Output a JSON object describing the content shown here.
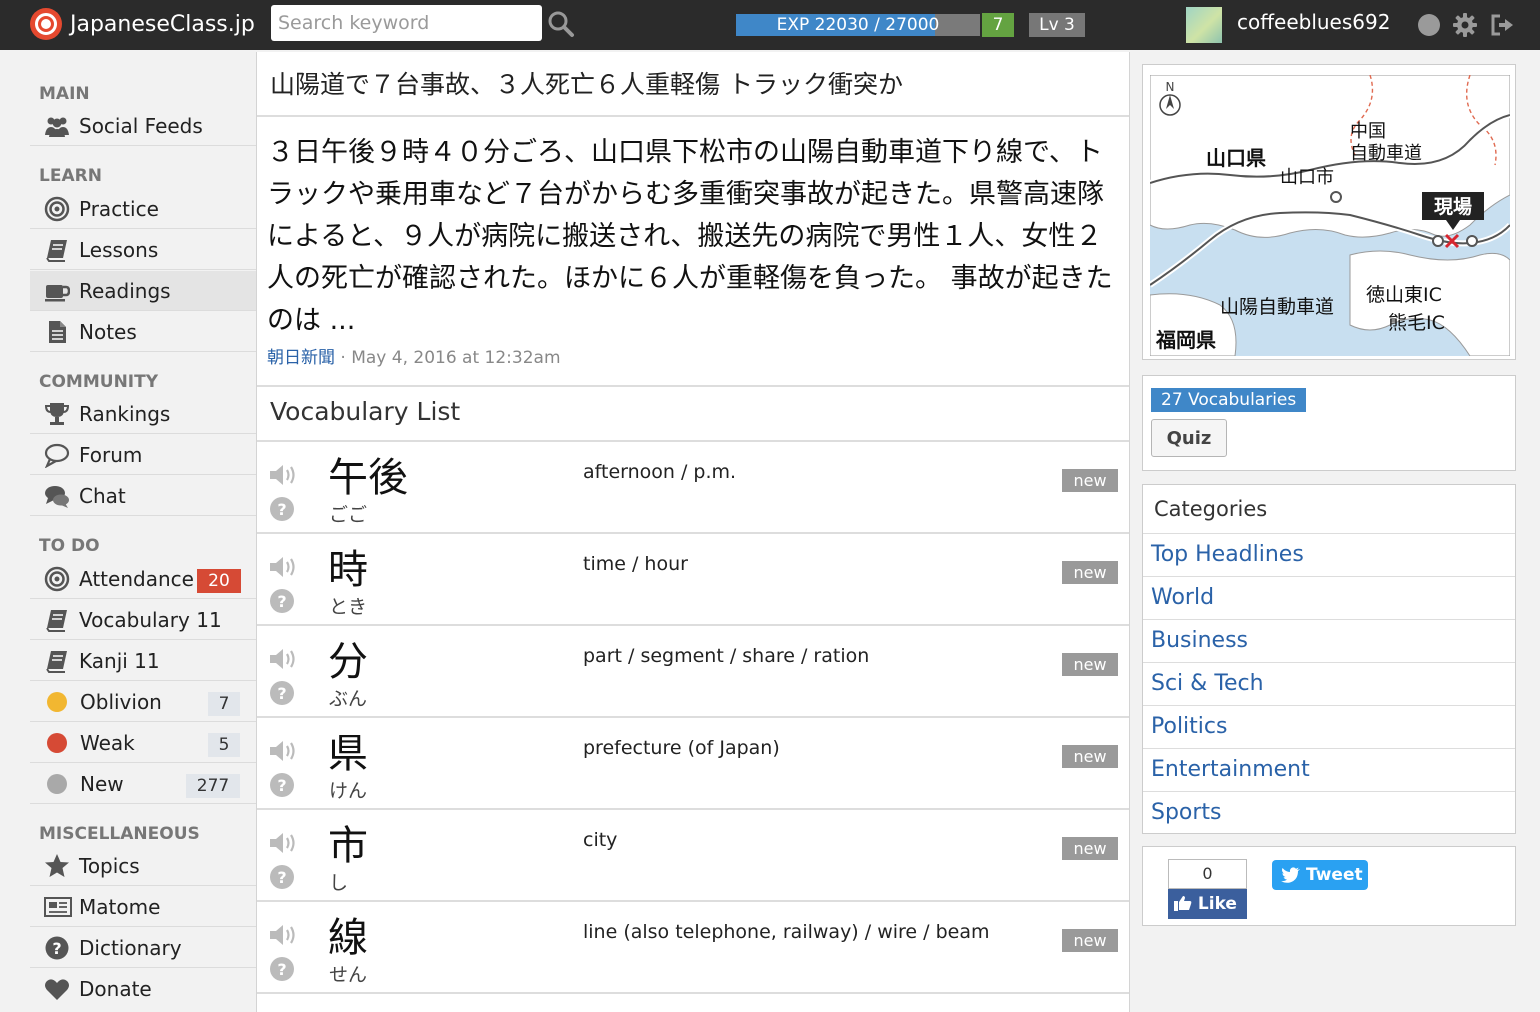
{
  "header": {
    "logo": "JapaneseClass.jp",
    "search_placeholder": "Search keyword",
    "exp_text": "EXP 22030 / 27000",
    "exp_progress": 0.816,
    "exp_number": "7",
    "level": "Lv 3",
    "username": "coffeeblues692",
    "colors": {
      "bar": "#2b2b2b",
      "exp": "#3f87c8",
      "exp_number": "#64a341"
    }
  },
  "sidebar": {
    "main_heading": "MAIN",
    "social_feeds": "Social Feeds",
    "learn_heading": "LEARN",
    "practice": "Practice",
    "lessons": "Lessons",
    "readings": "Readings",
    "notes": "Notes",
    "community_heading": "COMMUNITY",
    "rankings": "Rankings",
    "forum": "Forum",
    "chat": "Chat",
    "todo_heading": "TO DO",
    "attendance": "Attendance",
    "attendance_count": "20",
    "vocabulary": "Vocabulary 11",
    "kanji": "Kanji 11",
    "oblivion": "Oblivion",
    "oblivion_count": "7",
    "weak": "Weak",
    "weak_count": "5",
    "new": "New",
    "new_count": "277",
    "misc_heading": "MISCELLANEOUS",
    "topics": "Topics",
    "matome": "Matome",
    "dictionary": "Dictionary",
    "donate": "Donate",
    "colors": {
      "oblivion": "#f2b731",
      "weak": "#d64a35",
      "new": "#a9a9a9"
    }
  },
  "article": {
    "title": "山陽道で７台事故、３人死亡６人重軽傷 トラック衝突か",
    "body": "３日午後９時４０分ごろ、山口県下松市の山陽自動車道下り線で、トラックや乗用車など７台がからむ多重衝突事故が起きた。県警高速隊によると、９人が病院に搬送され、搬送先の病院で男性１人、女性２人の死亡が確認された。ほかに６人が重軽傷を負った。 事故が起きたのは ...",
    "source": "朝日新聞",
    "date": " · May 4, 2016 at 12:32am"
  },
  "vocab_list": {
    "heading": "Vocabulary List",
    "new_label": "new",
    "items": [
      {
        "kanji": "午後",
        "reading": "ごご",
        "meaning": "afternoon / p.m."
      },
      {
        "kanji": "時",
        "reading": "とき",
        "meaning": "time / hour"
      },
      {
        "kanji": "分",
        "reading": "ぶん",
        "meaning": "part / segment / share / ration"
      },
      {
        "kanji": "県",
        "reading": "けん",
        "meaning": "prefecture (of Japan)"
      },
      {
        "kanji": "市",
        "reading": "し",
        "meaning": "city"
      },
      {
        "kanji": "線",
        "reading": "せん",
        "meaning": "line (also telephone, railway) / wire / beam"
      }
    ]
  },
  "map": {
    "north": "N",
    "yamaguchi_pref": "山口県",
    "chugoku_expressway": "中国\n自動車道",
    "yamaguchi_city": "山口市",
    "scene": "現場",
    "tokuyama_ic": "徳山東IC",
    "kumage_ic": "熊毛IC",
    "sanyo_expressway": "山陽自動車道",
    "fukuoka_pref": "福岡県"
  },
  "right": {
    "vocab_count": "27 Vocabularies",
    "quiz": "Quiz",
    "categories_heading": "Categories",
    "categories": [
      "Top Headlines",
      "World",
      "Business",
      "Sci & Tech",
      "Politics",
      "Entertainment",
      "Sports"
    ],
    "fb_count": "0",
    "fb_like": "Like",
    "tweet": "Tweet"
  }
}
